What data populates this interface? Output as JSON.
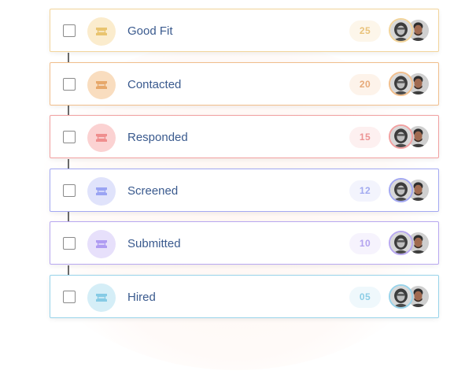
{
  "pipeline": {
    "stages": [
      {
        "label": "Good Fit",
        "count": "25",
        "color": "#f2d49a",
        "icon_bg": "#fbeccd",
        "icon_color": "#e9c46f",
        "badge_bg": "#fdf6ea",
        "badge_text": "#e9c27a",
        "icon": "ticket-icon"
      },
      {
        "label": "Contacted",
        "count": "20",
        "color": "#f1be8c",
        "icon_bg": "#f9ddbf",
        "icon_color": "#e7a86a",
        "badge_bg": "#fdf3ea",
        "badge_text": "#e6a978",
        "icon": "ticket-icon"
      },
      {
        "label": "Responded",
        "count": "15",
        "color": "#f1a0a0",
        "icon_bg": "#fbd2d2",
        "icon_color": "#ef8e8e",
        "badge_bg": "#fdf0f0",
        "badge_text": "#ec9494",
        "icon": "ticket-icon"
      },
      {
        "label": "Screened",
        "count": "12",
        "color": "#a3a8f2",
        "icon_bg": "#e0e3fb",
        "icon_color": "#9aa4f3",
        "badge_bg": "#f3f4fd",
        "badge_text": "#a2aaf0",
        "icon": "ticket-icon"
      },
      {
        "label": "Submitted",
        "count": "10",
        "color": "#b8a8f0",
        "icon_bg": "#e7e0fb",
        "icon_color": "#b09cf2",
        "badge_bg": "#f6f3fd",
        "badge_text": "#b3a3ef",
        "icon": "ticket-icon"
      },
      {
        "label": "Hired",
        "count": "05",
        "color": "#98d3ea",
        "icon_bg": "#d5eef7",
        "icon_color": "#86cbe5",
        "badge_bg": "#eff8fc",
        "badge_text": "#8ccde6",
        "icon": "ticket-icon"
      }
    ]
  }
}
